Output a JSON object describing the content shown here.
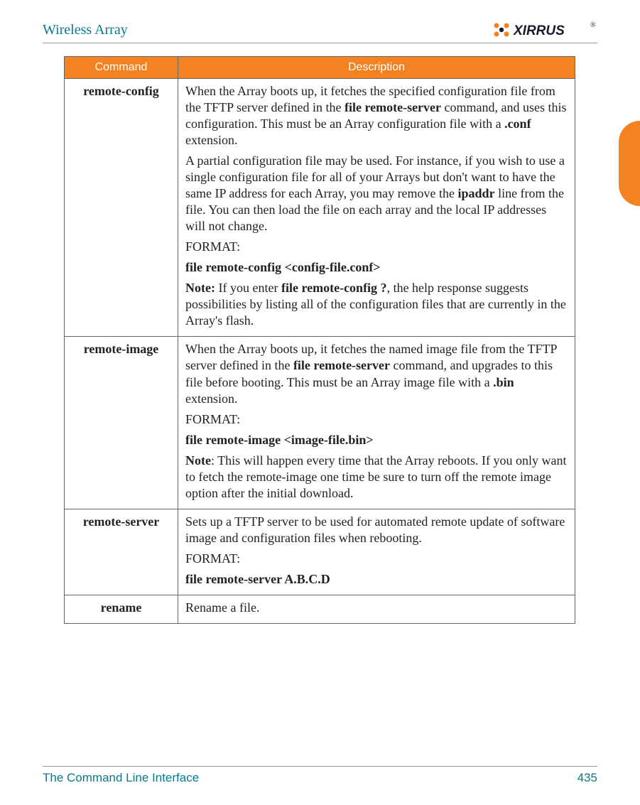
{
  "header": {
    "title": "Wireless Array",
    "logo_text": "XIRRUS"
  },
  "table": {
    "headers": {
      "command": "Command",
      "description": "Description"
    },
    "rows": [
      {
        "command": "remote-config",
        "desc": {
          "p1a": "When the Array boots up, it fetches the specified configuration file from the TFTP server defined in the ",
          "p1b": "file remote-server",
          "p1c": " command, and uses this configuration. This must be an Array configuration file with a ",
          "p1d": ".conf",
          "p1e": " extension.",
          "p2a": "A partial configuration file may be used. For instance, if you wish to use a single configuration file for all of your Arrays but don't want to have the same IP address for each Array, you may remove the ",
          "p2b": "ipaddr",
          "p2c": " line from the file. You can then load the file on each array and the local IP addresses will not change.",
          "p3": "FORMAT:",
          "p4": "file remote-config <config-file.conf>",
          "p5a": "Note:",
          "p5b": " If you enter ",
          "p5c": "file remote-config ?",
          "p5d": ", the help response suggests possibilities by listing all of the configuration files that are currently in the Array's flash."
        }
      },
      {
        "command": "remote-image",
        "desc": {
          "p1a": "When the Array boots up, it fetches the named image file from the TFTP server defined in the ",
          "p1b": "file remote-server",
          "p1c": " command, and upgrades to this file before booting. This must be an Array image file with a ",
          "p1d": ".bin",
          "p1e": " extension.",
          "p2": "FORMAT:",
          "p3": "file remote-image <image-file.bin>",
          "p4a": "Note",
          "p4b": ": This will happen every time that the Array reboots. If you only want to fetch the remote-image one time be sure to turn off the remote image option after the initial download."
        }
      },
      {
        "command": "remote-server",
        "desc": {
          "p1": "Sets up a TFTP server to be used for automated remote update of software image and configuration files when rebooting.",
          "p2": "FORMAT:",
          "p3": "file remote-server A.B.C.D"
        }
      },
      {
        "command": "rename",
        "desc": {
          "p1": "Rename a file."
        }
      }
    ]
  },
  "footer": {
    "section": "The Command Line Interface",
    "page": "435"
  }
}
